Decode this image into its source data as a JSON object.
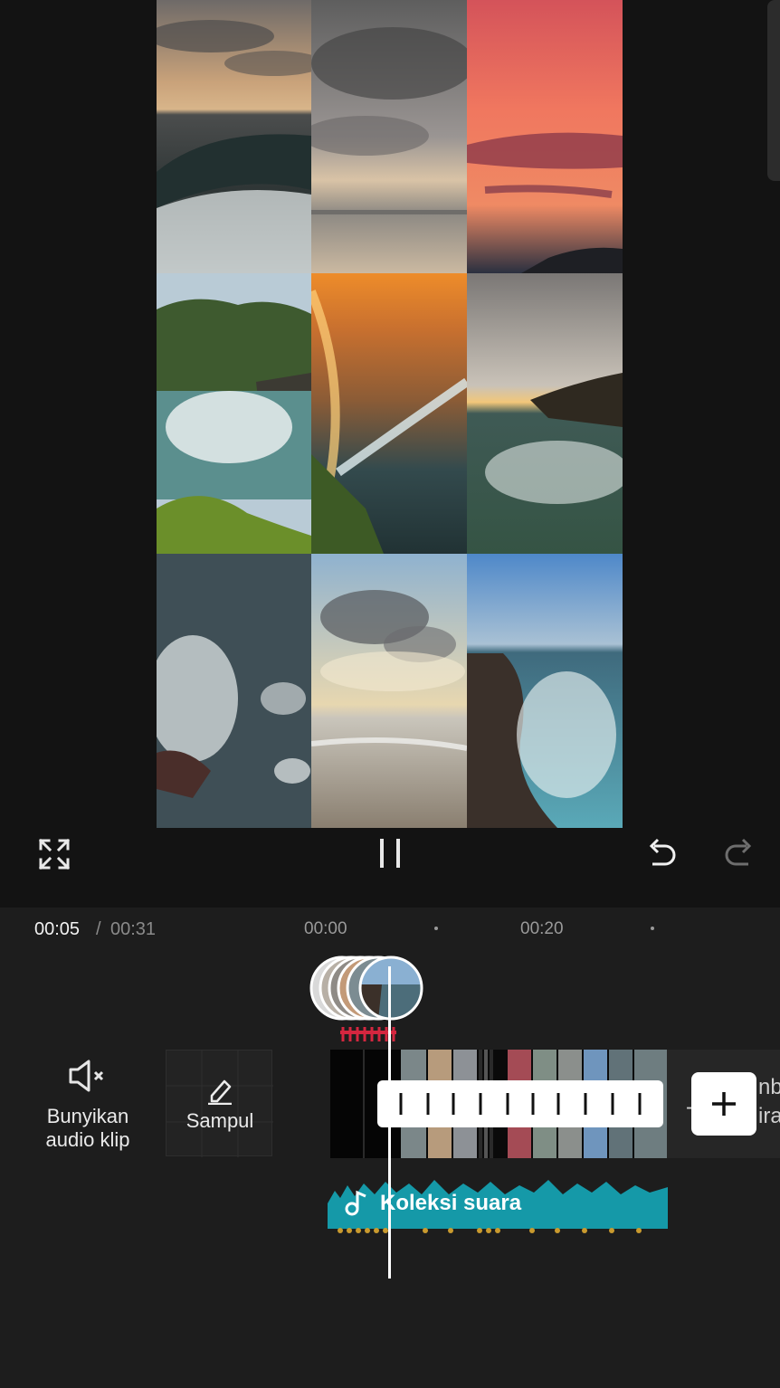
{
  "player": {
    "fullscreen_icon": "fullscreen-icon",
    "play_pause_icon": "pause-icon",
    "undo_icon": "undo-icon",
    "redo_icon": "redo-icon"
  },
  "timeline": {
    "current_time": "00:05",
    "separator": "/",
    "total_time": "00:31",
    "ruler_labels": [
      "00:00",
      "00:20"
    ]
  },
  "tools": {
    "mute_label": "Bunyikan audio klip",
    "cover_label": "Sampul"
  },
  "tracks": {
    "audio_label": "Koleksi suara",
    "add_clip_icon": "plus-icon",
    "right_strip_text1": "nb",
    "right_strip_text2": "ira",
    "right_strip_dash": "-"
  },
  "colors": {
    "background": "#131313",
    "panel": "#1d1d1d",
    "audio_track": "#1599a8",
    "audio_dots": "#c99a2e",
    "keyframe": "#d4263f"
  }
}
